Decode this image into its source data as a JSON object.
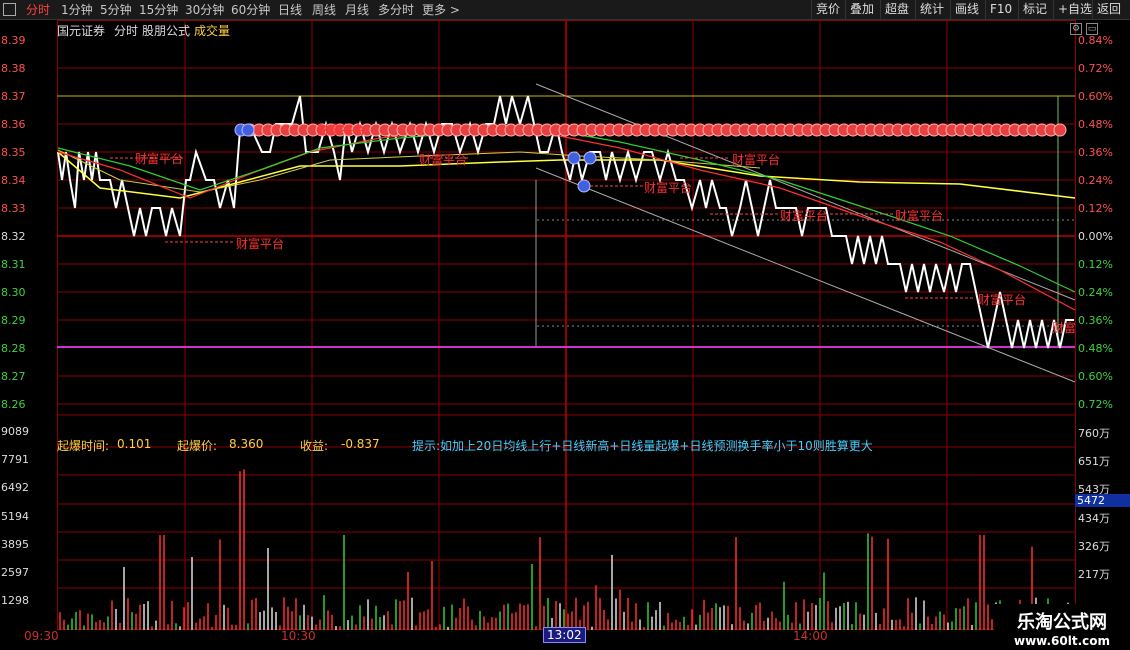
{
  "toolbar": {
    "periods": [
      "分时",
      "1分钟",
      "5分钟",
      "15分钟",
      "30分钟",
      "60分钟",
      "日线",
      "周线",
      "月线",
      "多分时",
      "更多 >"
    ],
    "active_period": "分时",
    "actions": [
      "竞价",
      "叠加",
      "超盘",
      "统计",
      "画线",
      "F10",
      "标记",
      "+自选",
      "返回"
    ]
  },
  "header": {
    "broker": "国元证券",
    "tab": "分时",
    "formula": "股朋公式",
    "indicator": "成交量"
  },
  "price_axis": {
    "left": [
      "8.39",
      "8.38",
      "8.37",
      "8.36",
      "8.35",
      "8.34",
      "8.33",
      "8.32",
      "8.31",
      "8.30",
      "8.29",
      "8.28",
      "8.27",
      "8.26"
    ],
    "right": [
      "0.84%",
      "0.72%",
      "0.60%",
      "0.48%",
      "0.36%",
      "0.24%",
      "0.12%",
      "0.00%",
      "0.12%",
      "0.24%",
      "0.36%",
      "0.48%",
      "0.60%",
      "0.72%"
    ]
  },
  "volume_axis": {
    "left": [
      "9089",
      "7791",
      "6492",
      "5194",
      "3895",
      "2597",
      "1298"
    ],
    "right": [
      "760万",
      "651万",
      "543万",
      "434万",
      "326万",
      "217万"
    ],
    "current": "5472"
  },
  "time_axis": [
    "09:30",
    "10:30",
    "13:02",
    "14:00"
  ],
  "status": {
    "label1": "起爆时间:",
    "value1": "0.101",
    "label2": "起爆价:",
    "value2": "8.360",
    "label3": "收益:",
    "value3": "-0.837",
    "hint": "提示:如加上20日均线上行+日线新高+日线量起爆+日线预测换手率小于10则胜算更大"
  },
  "annotations": [
    "财富平台",
    "财富平台",
    "财富平台",
    "财富平台",
    "财富平台",
    "财富平台",
    "财富平台",
    "财富平台",
    "财富平台",
    "财富"
  ],
  "watermark": {
    "line1": "乐淘公式网",
    "line2": "www.60lt.com"
  },
  "colors": {
    "up": "#ff3030",
    "down": "#30d030",
    "price": "#ffffff",
    "avg": "#ffff40",
    "grid": "#8b0000",
    "accent": "#ff4040"
  }
}
